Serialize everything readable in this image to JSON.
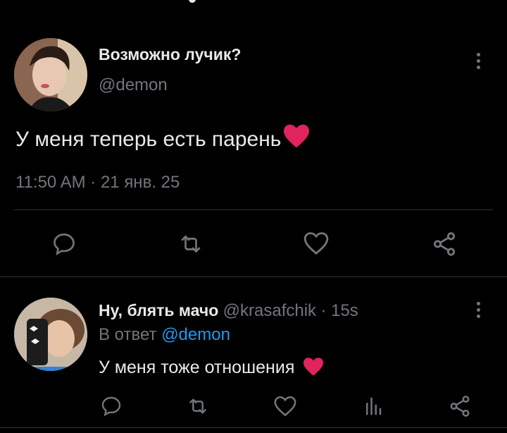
{
  "tweet": {
    "display_name": "Возможно лучик?",
    "handle": "@demon",
    "text": "У меня теперь есть парень",
    "emoji": "❤️",
    "timestamp": "11:50 AM · 21 янв. 25",
    "actions": [
      "reply-icon",
      "retweet-icon",
      "like-icon",
      "share-icon"
    ]
  },
  "reply": {
    "display_name": "Ну, блять мачо",
    "handle": "@krasafchik",
    "dot_time": "· 15s",
    "reply_prefix": "В ответ",
    "reply_to": "@demon",
    "text": "У меня тоже отношения",
    "emoji": "❤️",
    "actions": [
      "reply-icon",
      "retweet-icon",
      "like-icon",
      "views-icon",
      "share-icon"
    ]
  },
  "colors": {
    "background": "#000000",
    "text": "#e7e9ea",
    "muted": "#71767b",
    "link": "#1d9bf0",
    "heart": "#e0245e"
  }
}
